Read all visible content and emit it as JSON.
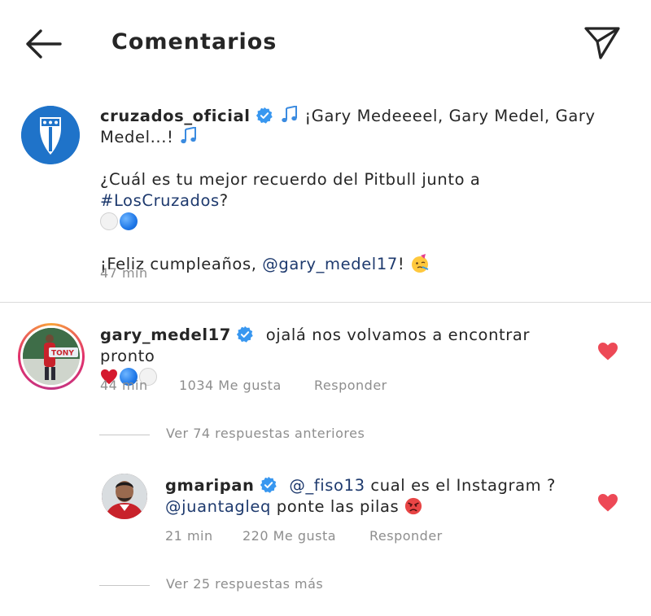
{
  "header": {
    "title": "Comentarios",
    "back_icon": "arrow-left-icon",
    "share_icon": "paper-plane-icon"
  },
  "caption": {
    "username": "cruzados_oficial",
    "line1_text": "¡Gary Medeeeel, Gary Medel, Gary Medel...!",
    "para2_text": "¿Cuál es tu mejor recuerdo del Pitbull junto a ",
    "para2_hashtag": "#LosCruzados",
    "para2_end": "?",
    "para3_text": "¡Feliz cumpleaños, ",
    "para3_mention": "@gary_medel17",
    "para3_end": "!",
    "time": "47 min"
  },
  "comment1": {
    "username": "gary_medel17",
    "text": "ojalá nos volvamos a encontrar pronto",
    "time": "44 min",
    "likes": "1034 Me gusta",
    "reply_label": "Responder",
    "liked": true
  },
  "view_previous": {
    "label": "Ver 74 respuestas anteriores"
  },
  "reply1": {
    "username": "gmaripan",
    "mention1": "@_fiso13",
    "text1": "cual es el Instagram ?",
    "mention2": "@juantagleq",
    "text2": "ponte las pilas",
    "time": "21 min",
    "likes": "220 Me gusta",
    "reply_label": "Responder",
    "liked": true
  },
  "view_more": {
    "label": "Ver 25 respuestas más"
  },
  "colors": {
    "text": "#262626",
    "secondary": "#8e8e8e",
    "link": "#1e3a6e",
    "heart": "#ed4956",
    "verified": "#3897f0",
    "club_blue": "#1f73c9"
  }
}
